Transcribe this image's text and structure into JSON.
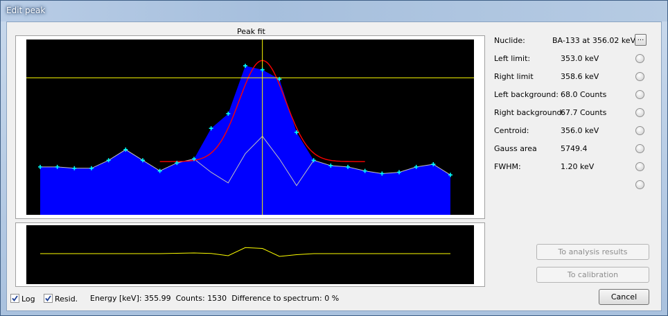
{
  "window": {
    "title": "Edit peak"
  },
  "plot": {
    "title": "Peak fit"
  },
  "fields": [
    {
      "label": "Nuclide:",
      "value": "BA-133 at 356.02 keV"
    },
    {
      "label": "Left limit:",
      "value": "353.0  keV"
    },
    {
      "label": "Right limit",
      "value": "358.6  keV"
    },
    {
      "label": "Left background:",
      "value": "68.0 Counts"
    },
    {
      "label": "Right background:",
      "value": "67.7 Counts"
    },
    {
      "label": "Centroid:",
      "value": "356.0  keV"
    },
    {
      "label": "Gauss area",
      "value": "5749.4"
    },
    {
      "label": "FWHM:",
      "value": "1.20  keV"
    }
  ],
  "nuclide_button": "...",
  "buttons": {
    "analysis": "To analysis results",
    "calibration": "To calibration",
    "cancel": "Cancel"
  },
  "options": {
    "log_label": "Log",
    "log_checked": true,
    "resid_label": "Resid.",
    "resid_checked": true
  },
  "status": {
    "energy_label": "Energy [keV]:",
    "energy": "355.99",
    "counts_label": "Counts:",
    "counts": "1530",
    "diff_label": "Difference to spectrum:",
    "diff": "0 %"
  },
  "colors": {
    "plot_bg": "#000000",
    "fill": "#0000ff",
    "fit": "#ff0000",
    "cursor": "#ffff00",
    "markers": "#00ffff",
    "background": "#c0c0c0"
  },
  "chart_data": {
    "type": "area",
    "spectrum": [
      0.36,
      0.36,
      0.35,
      0.35,
      0.41,
      0.49,
      0.41,
      0.33,
      0.39,
      0.42,
      0.65,
      0.76,
      1.12,
      1.09,
      1.02,
      0.62,
      0.41,
      0.37,
      0.36,
      0.33,
      0.31,
      0.32,
      0.36,
      0.38,
      0.3
    ],
    "background": [
      0.36,
      0.36,
      0.35,
      0.35,
      0.41,
      0.49,
      0.41,
      0.33,
      0.39,
      0.42,
      0.32,
      0.24,
      0.46,
      0.59,
      0.42,
      0.22,
      0.41,
      0.37,
      0.36,
      0.33,
      0.31,
      0.32,
      0.36,
      0.38,
      0.3
    ],
    "fit_range": [
      7,
      19
    ],
    "fit_peak_index": 13,
    "fit_peak_value": 1.16,
    "fit_baseline": 0.4,
    "fit_sigma": 1.35,
    "markers_range": [
      0,
      24
    ],
    "cursor_x_index": 13,
    "cursor_y_value": 1.03,
    "residual": [
      0,
      0,
      0,
      0,
      0,
      0,
      0,
      0,
      0.02,
      0.04,
      0.01,
      -0.12,
      0.35,
      0.3,
      -0.16,
      -0.06,
      0,
      0,
      0,
      0,
      0,
      0,
      0,
      0,
      0
    ]
  }
}
